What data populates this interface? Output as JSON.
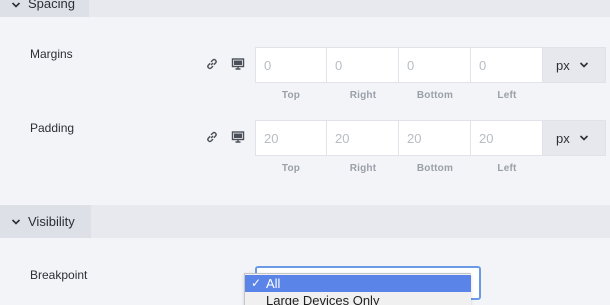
{
  "sections": {
    "spacing": {
      "title": "Spacing"
    },
    "visibility": {
      "title": "Visibility"
    }
  },
  "margins": {
    "label": "Margins",
    "values": [
      "0",
      "0",
      "0",
      "0"
    ],
    "unit": "px"
  },
  "padding": {
    "label": "Padding",
    "values": [
      "20",
      "20",
      "20",
      "20"
    ],
    "unit": "px"
  },
  "side_labels": [
    "Top",
    "Right",
    "Bottom",
    "Left"
  ],
  "breakpoint": {
    "label": "Breakpoint",
    "options": [
      "All",
      "Large Devices Only"
    ],
    "selected": "All",
    "check_mark": "✓"
  },
  "icons": {
    "link": "link-icon",
    "responsive": "desktop-icon",
    "chevron": "chevron-down-icon"
  }
}
